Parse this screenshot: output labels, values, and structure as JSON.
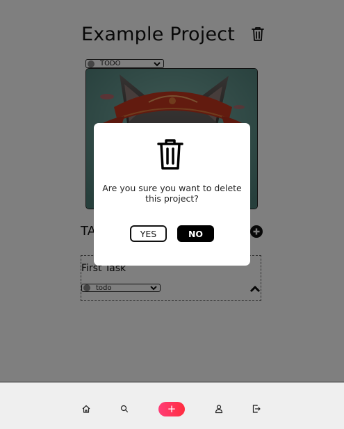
{
  "project": {
    "title": "Example Project",
    "status": "TODO",
    "image_alt": "cat wearing a red headband"
  },
  "tasks": {
    "heading": "TA",
    "items": [
      {
        "title": "First Task",
        "status": "todo"
      }
    ]
  },
  "dialog": {
    "message": "Are you sure you want to delete this project?",
    "yes_label": "YES",
    "no_label": "NO"
  },
  "nav": {
    "add_label": "+",
    "items": [
      "home-icon",
      "search-icon",
      "add-icon",
      "user-icon",
      "logout-icon"
    ]
  },
  "colors": {
    "accent_gradient_start": "#ff3d77",
    "accent_gradient_end": "#ff2d3f",
    "overlay": "rgba(0,0,0,0.5)",
    "status_dot": "#8a8a8a"
  }
}
